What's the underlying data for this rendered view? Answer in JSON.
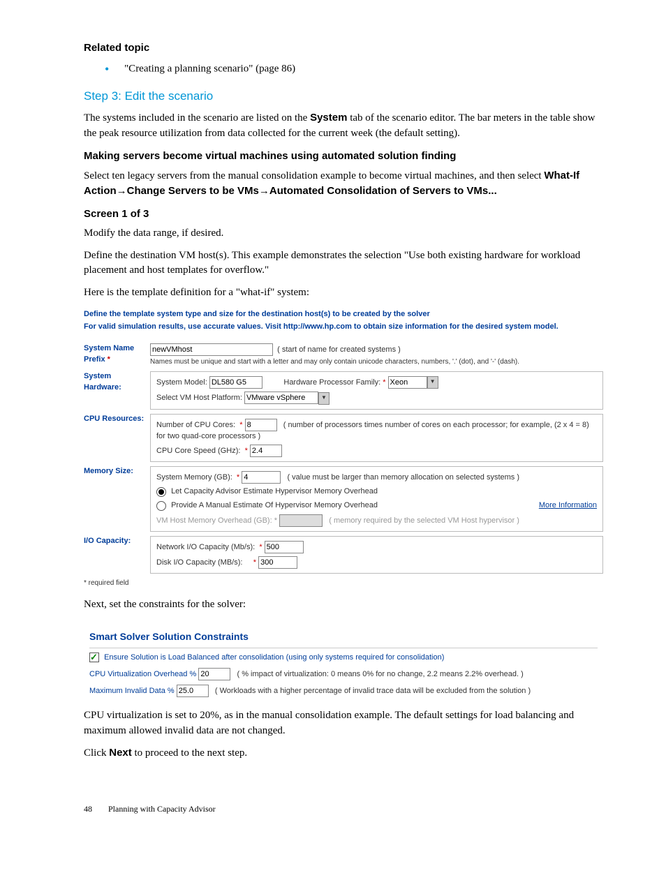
{
  "related": {
    "heading": "Related topic",
    "item": "\"Creating a planning scenario\" (page 86)"
  },
  "step3": {
    "title": "Step 3: Edit the scenario",
    "p1a": "The systems included in the scenario are listed on the ",
    "p1b": "System",
    "p1c": " tab of the scenario editor. The bar meters in the table show the peak resource utilization from data collected for the current week (the default setting)."
  },
  "making": {
    "heading": "Making servers become virtual machines using automated solution finding",
    "p1a": "Select ten legacy servers from the manual consolidation example to become virtual machines, and then select ",
    "p1b": "What-If Action→Change Servers to be VMs→Automated Consolidation of Servers to VMs..."
  },
  "screen1": {
    "heading": "Screen 1 of 3",
    "p1": "Modify the data range, if desired.",
    "p2": "Define the destination VM host(s). This example demonstrates the selection \"Use both existing hardware for workload placement and host templates for overflow.\"",
    "p3": "Here is the template definition for a \"what-if\" system:"
  },
  "form": {
    "intro1": "Define the template system type and size for the destination host(s) to be created by the solver",
    "intro2": "For valid simulation results, use accurate values. Visit http://www.hp.com to obtain size information for the desired system model.",
    "sysname_label": "System Name Prefix",
    "sysname_value": "newVMhost",
    "sysname_hint": "( start of name for created systems )",
    "sysname_note": "Names must be unique and start with a letter and may only contain unicode characters, numbers, '.' (dot), and '-' (dash).",
    "syshw_label": "System Hardware:",
    "model_label": "System Model:",
    "model_value": "DL580 G5",
    "hwproc_label": "Hardware Processor Family: ",
    "hwproc_value": "Xeon",
    "vmhost_label": "Select VM Host Platform:",
    "vmhost_value": "VMware vSphere",
    "cpu_label": "CPU Resources:",
    "ncores_label": "Number of CPU Cores:",
    "ncores_value": "8",
    "ncores_hint": "( number of processors times number of cores on each processor; for example, (2 x 4 = 8) for two quad-core processors )",
    "cspeed_label": "CPU Core Speed (GHz):",
    "cspeed_value": "2.4",
    "mem_label": "Memory Size:",
    "sysmem_label": "System Memory (GB):",
    "sysmem_value": "4",
    "sysmem_hint": "( value must be larger than memory allocation on selected systems )",
    "r1": "Let Capacity Advisor Estimate Hypervisor Memory Overhead",
    "r2": "Provide A Manual Estimate Of Hypervisor Memory Overhead",
    "moreinfo": "More Information",
    "vmover_label": "VM Host Memory Overhead (GB): *",
    "vmover_hint": "( memory required by the selected VM Host hypervisor )",
    "io_label": "I/O Capacity:",
    "net_label": "Network I/O Capacity (Mb/s):",
    "net_value": "500",
    "disk_label": "Disk I/O Capacity (MB/s):",
    "disk_value": "300",
    "req": "* required field"
  },
  "next_constraints": "Next, set the constraints for the solver:",
  "constraints": {
    "title": "Smart Solver Solution Constraints",
    "cb1": "Ensure Solution is Load Balanced after consolidation (using only systems required for consolidation)",
    "cpuo_label": "CPU Virtualization Overhead %",
    "cpuo_value": "20",
    "cpuo_hint": "( % impact of virtualization: 0 means 0% for no change, 2.2 means 2.2% overhead. )",
    "maxinv_label": "Maximum Invalid Data %",
    "maxinv_value": "25.0",
    "maxinv_hint": "( Workloads with a higher percentage of invalid trace data will be excluded from the solution )"
  },
  "closing": {
    "p1": "CPU virtualization is set to 20%, as in the manual consolidation example. The default settings for load balancing and maximum allowed invalid data are not changed.",
    "p2a": "Click ",
    "p2b": "Next",
    "p2c": " to proceed to the next step."
  },
  "footer": {
    "page": "48",
    "chapter": "Planning with Capacity Advisor"
  }
}
